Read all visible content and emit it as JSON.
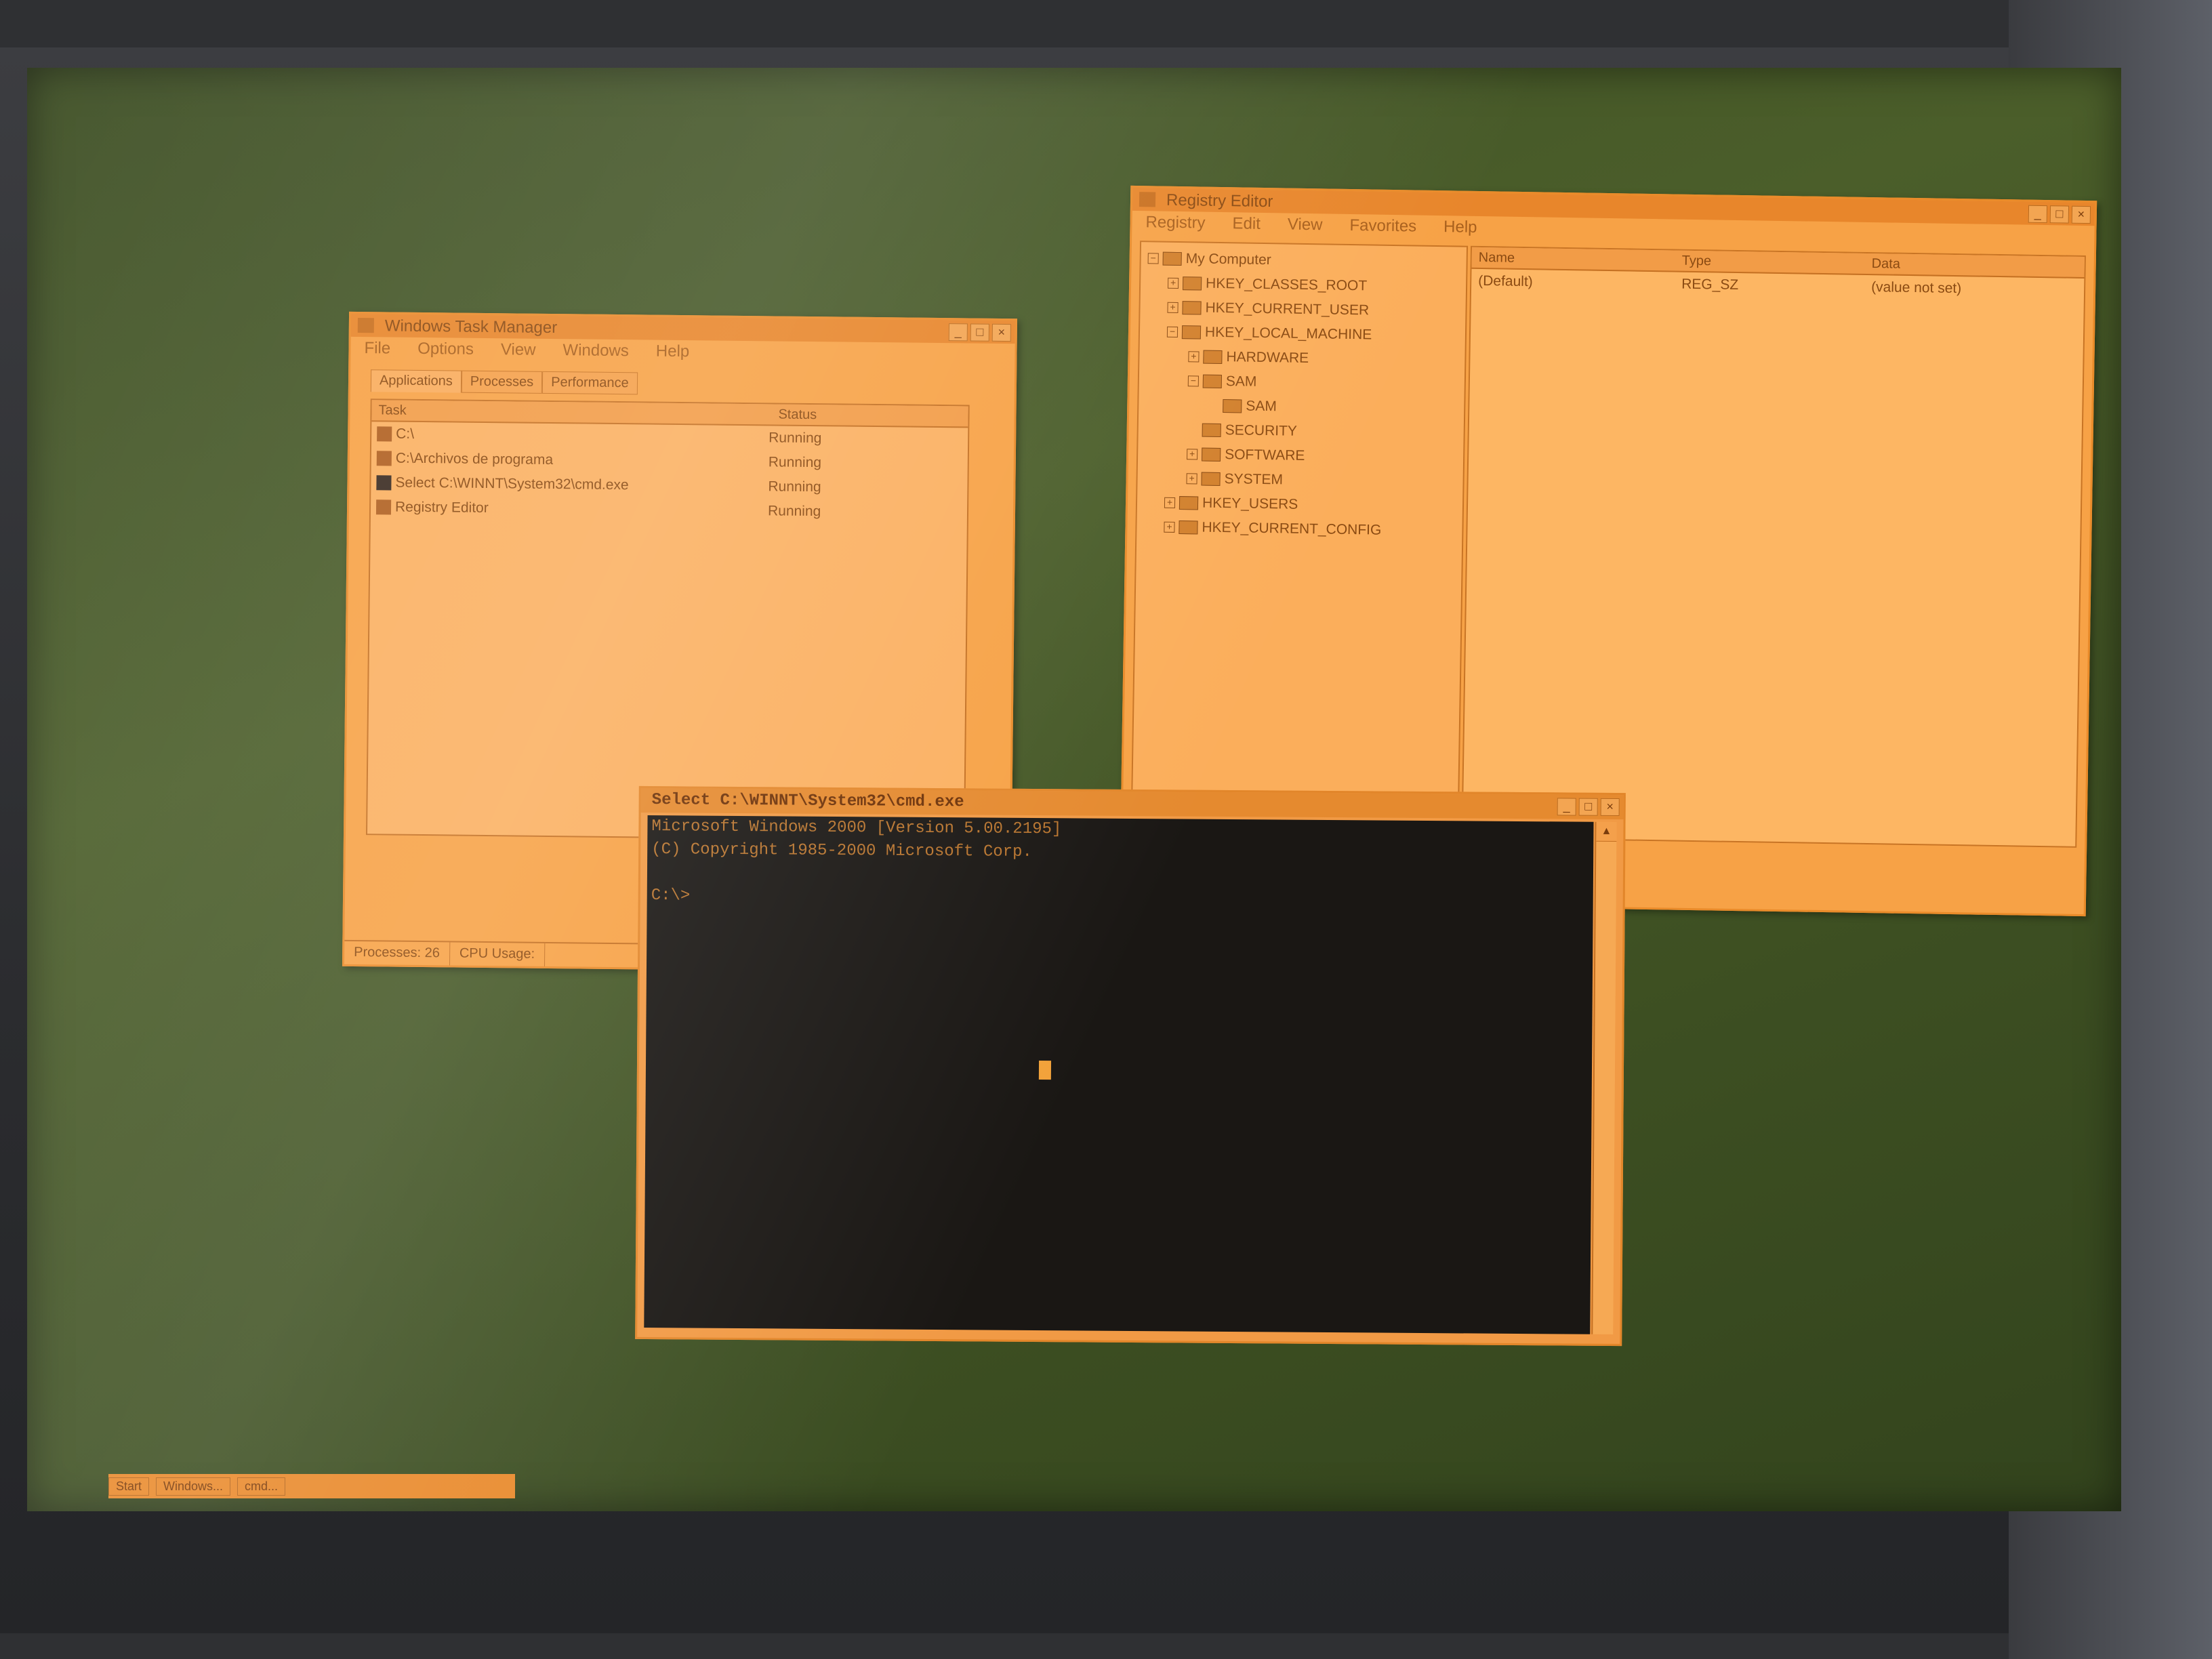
{
  "task_manager": {
    "title": "Windows Task Manager",
    "menu": [
      "File",
      "Options",
      "View",
      "Windows",
      "Help"
    ],
    "tabs": [
      "Applications",
      "Processes",
      "Performance"
    ],
    "columns": [
      "Task",
      "Status"
    ],
    "rows": [
      {
        "task": "C:\\",
        "status": "Running"
      },
      {
        "task": "C:\\Archivos de programa",
        "status": "Running"
      },
      {
        "task": "Select C:\\WINNT\\System32\\cmd.exe",
        "status": "Running"
      },
      {
        "task": "Registry Editor",
        "status": "Running"
      }
    ],
    "status_processes": "Processes: 26",
    "status_cpu": "CPU Usage:"
  },
  "registry_editor": {
    "title": "Registry Editor",
    "menu": [
      "Registry",
      "Edit",
      "View",
      "Favorites",
      "Help"
    ],
    "tree": [
      {
        "label": "My Computer",
        "level": 0,
        "expander": "-"
      },
      {
        "label": "HKEY_CLASSES_ROOT",
        "level": 1,
        "expander": "+"
      },
      {
        "label": "HKEY_CURRENT_USER",
        "level": 1,
        "expander": "+"
      },
      {
        "label": "HKEY_LOCAL_MACHINE",
        "level": 1,
        "expander": "-"
      },
      {
        "label": "HARDWARE",
        "level": 2,
        "expander": "+"
      },
      {
        "label": "SAM",
        "level": 2,
        "expander": "-"
      },
      {
        "label": "SAM",
        "level": 3,
        "expander": ""
      },
      {
        "label": "SECURITY",
        "level": 2,
        "expander": ""
      },
      {
        "label": "SOFTWARE",
        "level": 2,
        "expander": "+"
      },
      {
        "label": "SYSTEM",
        "level": 2,
        "expander": "+"
      },
      {
        "label": "HKEY_USERS",
        "level": 1,
        "expander": "+"
      },
      {
        "label": "HKEY_CURRENT_CONFIG",
        "level": 1,
        "expander": "+"
      }
    ],
    "columns": [
      "Name",
      "Type",
      "Data"
    ],
    "values": [
      {
        "name": "(Default)",
        "type": "REG_SZ",
        "data": "(value not set)"
      }
    ]
  },
  "console": {
    "title": "Select C:\\WINNT\\System32\\cmd.exe",
    "lines": [
      "Microsoft Windows 2000 [Version 5.00.2195]",
      "(C) Copyright 1985-2000 Microsoft Corp.",
      "",
      "C:\\>"
    ]
  },
  "taskbar": {
    "items": [
      "Start",
      "Windows...",
      "cmd..."
    ]
  },
  "colors": {
    "window": "#f7a246",
    "desktop": "#4b5e2a",
    "console_bg": "#1a1714"
  }
}
